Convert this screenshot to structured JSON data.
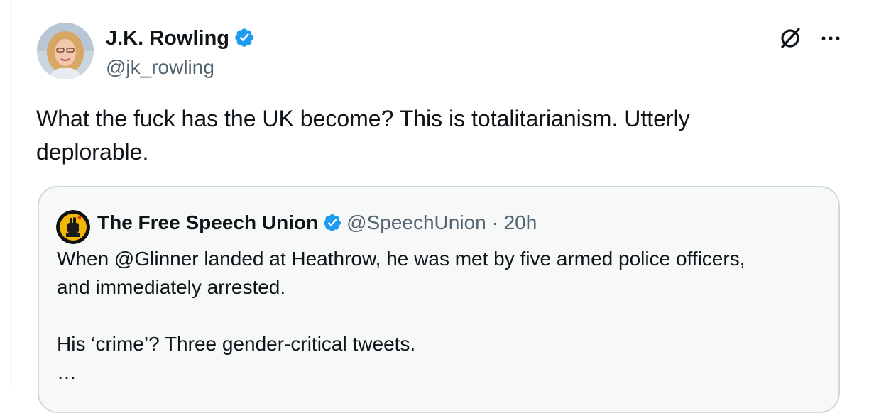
{
  "author": {
    "name": "J.K. Rowling",
    "handle": "@jk_rowling"
  },
  "tweet": {
    "text": "What the fuck has the UK become? This is totalitarianism. Utterly deplorable."
  },
  "icons": {
    "verified": "verified-badge-icon",
    "grok": "grok-icon",
    "more": "more-options-icon"
  },
  "colors": {
    "verified_blue": "#1d9bf0",
    "text": "#0f1419",
    "secondary_text": "#536471",
    "quote_background": "#f7f9f9",
    "quote_border": "#cfd9de"
  },
  "quote": {
    "author_name": "The Free Speech Union",
    "handle": "@SpeechUnion",
    "separator": "·",
    "time": "20h",
    "lines": [
      "When @Glinner landed at Heathrow, he was met by five armed police officers,",
      "and immediately arrested.",
      "His ‘crime’? Three gender-critical tweets.",
      "…"
    ]
  }
}
